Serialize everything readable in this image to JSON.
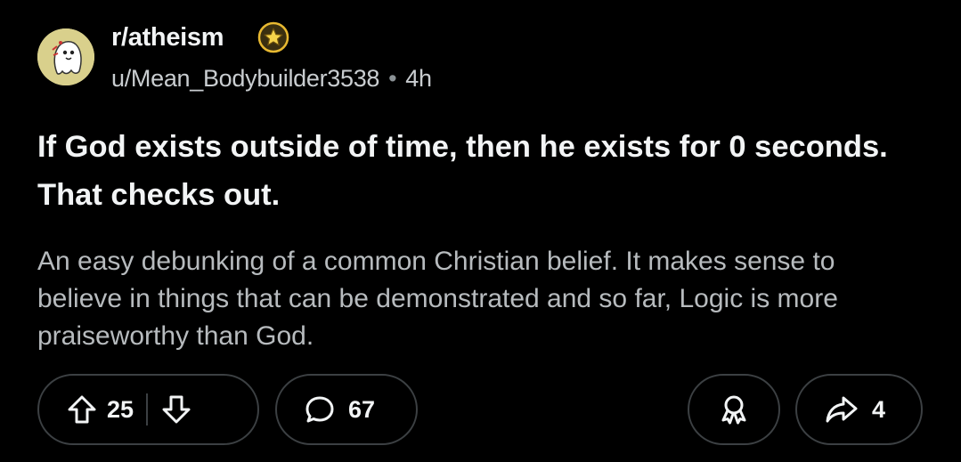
{
  "post": {
    "subreddit": "r/atheism",
    "author": "u/Mean_Bodybuilder3538",
    "separator": "•",
    "age": "4h",
    "title": "If God exists outside of time, then he exists for 0 seconds. That checks out.",
    "body": "An easy debunking of a common Christian belief. It makes sense to believe in things that can be demonstrated and so far, Logic is more praiseworthy than God."
  },
  "actions": {
    "upvotes": "25",
    "comments": "67",
    "shares": "4"
  },
  "icons": {
    "subreddit_avatar": "ghost-avatar-icon",
    "award": "star-award-icon",
    "upvote": "arrow-up-icon",
    "downvote": "arrow-down-icon",
    "comment": "speech-bubble-icon",
    "award_action": "award-ribbon-icon",
    "share": "share-arrow-icon"
  },
  "colors": {
    "background": "#000000",
    "title_text": "#f2f4f5",
    "body_text": "#b7bbbe",
    "meta_text": "#c9cdd0",
    "pill_border": "#3c4043",
    "award_gold": "#e8b931"
  }
}
